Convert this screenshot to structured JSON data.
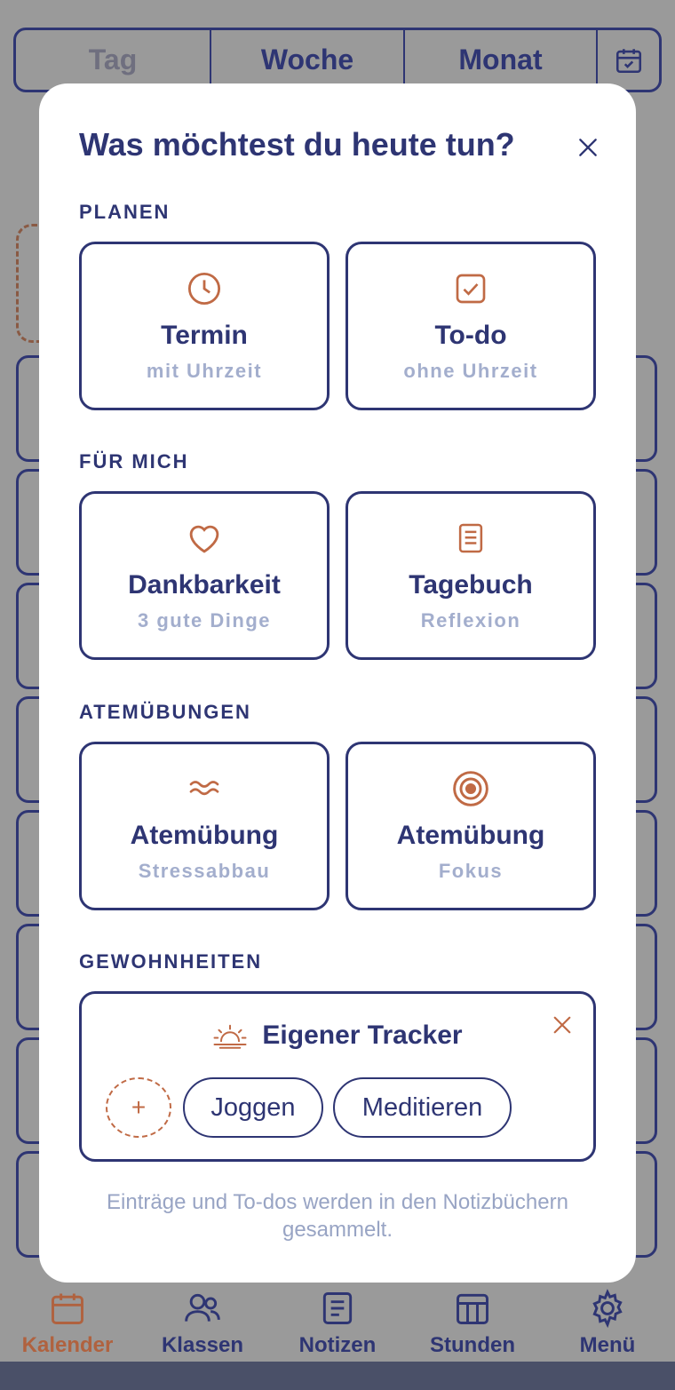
{
  "view_switcher": {
    "day": "Tag",
    "week": "Woche",
    "month": "Monat"
  },
  "modal": {
    "title": "Was möchtest du heute tun?",
    "sections": [
      {
        "label": "PLANEN",
        "cards": [
          {
            "icon": "clock-icon",
            "title": "Termin",
            "subtitle": "mit Uhrzeit"
          },
          {
            "icon": "checkbox-icon",
            "title": "To-do",
            "subtitle": "ohne Uhrzeit"
          }
        ]
      },
      {
        "label": "FÜR MICH",
        "cards": [
          {
            "icon": "heart-icon",
            "title": "Dankbarkeit",
            "subtitle": "3 gute Dinge"
          },
          {
            "icon": "document-icon",
            "title": "Tagebuch",
            "subtitle": "Reflexion"
          }
        ]
      },
      {
        "label": "ATEMÜBUNGEN",
        "cards": [
          {
            "icon": "waves-icon",
            "title": "Atemübung",
            "subtitle": "Stressabbau"
          },
          {
            "icon": "target-icon",
            "title": "Atemübung",
            "subtitle": "Fokus"
          }
        ]
      },
      {
        "label": "GEWOHNHEITEN"
      }
    ],
    "tracker": {
      "icon": "sunrise-icon",
      "title": "Eigener Tracker",
      "add_symbol": "+",
      "chips": [
        "Joggen",
        "Meditieren"
      ]
    },
    "footer_note": "Einträge und To-dos werden in den Notizbüchern gesammelt."
  },
  "bottom_nav": [
    {
      "icon": "calendar-icon",
      "label": "Kalender",
      "active": true
    },
    {
      "icon": "people-icon",
      "label": "Klassen"
    },
    {
      "icon": "notes-icon",
      "label": "Notizen"
    },
    {
      "icon": "timetable-icon",
      "label": "Stunden"
    },
    {
      "icon": "gear-icon",
      "label": "Menü"
    }
  ],
  "colors": {
    "navy": "#2e3573",
    "accent": "#c06a45",
    "muted": "#a3aecd"
  }
}
